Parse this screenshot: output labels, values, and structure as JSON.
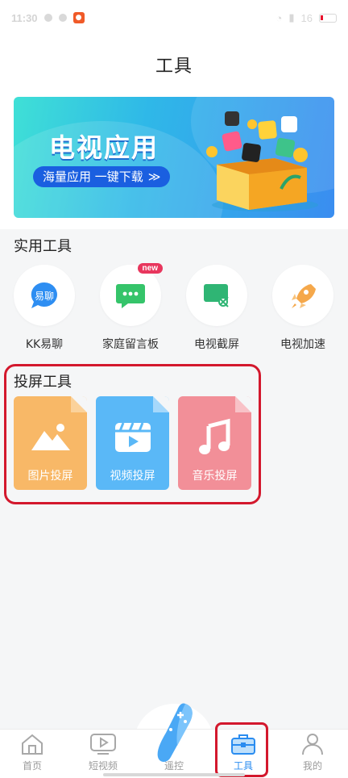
{
  "status_bar": {
    "time": "11:30",
    "right_text": "16"
  },
  "header": {
    "title": "工具"
  },
  "banner": {
    "title": "电视应用",
    "cta": "海量应用 一键下载",
    "cta_arrows": "≫"
  },
  "sections": {
    "utility": {
      "title": "实用工具",
      "items": [
        {
          "label": "KK易聊",
          "icon_text": "易聊",
          "icon": "chat-bubble-icon",
          "color": "#2e8ef2"
        },
        {
          "label": "家庭留言板",
          "icon": "message-board-icon",
          "badge": "new",
          "color": "#35c46a"
        },
        {
          "label": "电视截屏",
          "icon": "screenshot-icon",
          "color": "#2fb574"
        },
        {
          "label": "电视加速",
          "icon": "rocket-icon",
          "color": "#f5a84b"
        }
      ]
    },
    "cast": {
      "title": "投屏工具",
      "items": [
        {
          "label": "图片投屏",
          "icon": "image-icon",
          "color": "#f8b867"
        },
        {
          "label": "视频投屏",
          "icon": "video-icon",
          "color": "#5ab8f7"
        },
        {
          "label": "音乐投屏",
          "icon": "music-note-icon",
          "color": "#f28f98"
        }
      ]
    }
  },
  "bottom_nav": {
    "items": [
      {
        "label": "首页",
        "icon": "home-icon"
      },
      {
        "label": "短视频",
        "icon": "short-video-icon"
      },
      {
        "label": "遥控",
        "icon": "remote-control-icon"
      },
      {
        "label": "工具",
        "icon": "toolbox-icon",
        "active": true
      },
      {
        "label": "我的",
        "icon": "profile-icon"
      }
    ],
    "active_color": "#2a8cf0"
  }
}
